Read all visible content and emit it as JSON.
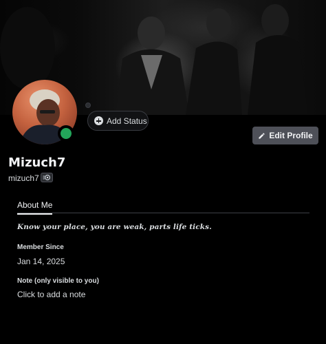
{
  "profile": {
    "display_name": "Mizuch7",
    "username": "mizuch7",
    "online_status_color": "#23a55a"
  },
  "actions": {
    "add_status_label": "Add Status",
    "edit_profile_label": "Edit Profile"
  },
  "tabs": [
    {
      "label": "About Me",
      "active": true
    }
  ],
  "about": {
    "bio": "Know your place, you are weak, parts life ticks.",
    "member_since_title": "Member Since",
    "member_since_value": "Jan 14, 2025",
    "note_title": "Note (only visible to you)",
    "note_placeholder": "Click to add a note"
  },
  "colors": {
    "background": "#000000",
    "button_gray": "#4e5058",
    "text": "#dbdee1"
  },
  "icons": {
    "add_status": "plus-circle-icon",
    "edit_profile": "pencil-icon",
    "badge": "nitro-badge-icon"
  }
}
